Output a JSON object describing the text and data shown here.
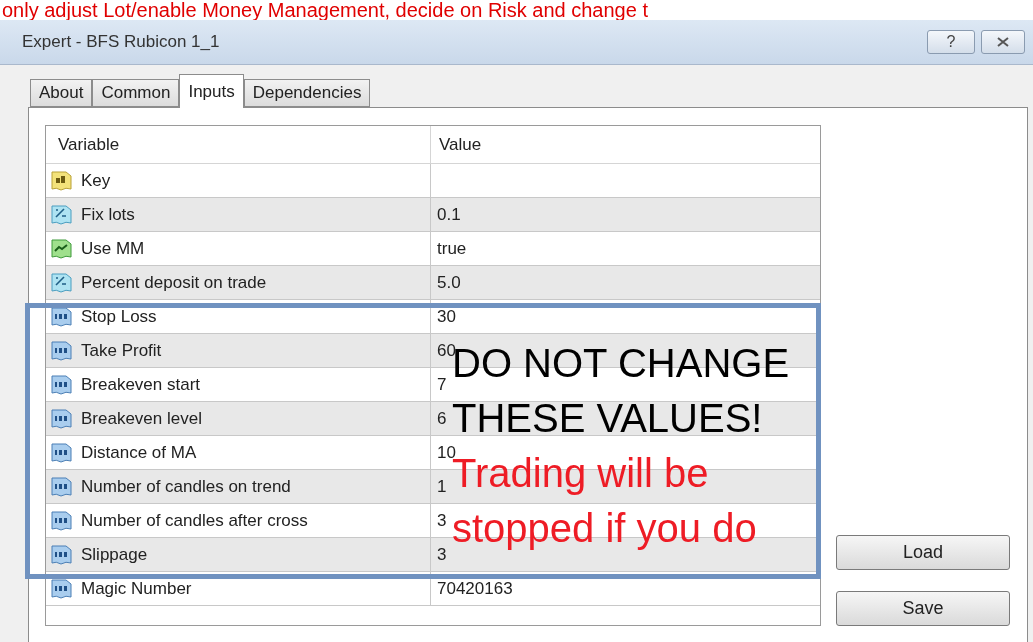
{
  "banner": "only adjust Lot/enable Money Management, decide on Risk and change t",
  "window": {
    "title": "Expert - BFS Rubicon 1_1",
    "help_button": "?"
  },
  "tabs": [
    {
      "label": "About",
      "selected": false
    },
    {
      "label": "Common",
      "selected": false
    },
    {
      "label": "Inputs",
      "selected": true
    },
    {
      "label": "Dependencies",
      "selected": false
    }
  ],
  "table": {
    "columns": [
      "Variable",
      "Value"
    ],
    "rows": [
      {
        "kind": "string",
        "variable": "Key",
        "value": ""
      },
      {
        "kind": "double",
        "variable": "Fix lots",
        "value": "0.1"
      },
      {
        "kind": "bool",
        "variable": "Use MM",
        "value": "true"
      },
      {
        "kind": "double",
        "variable": "Percent deposit on trade",
        "value": "5.0"
      },
      {
        "kind": "int",
        "variable": "Stop Loss",
        "value": "30"
      },
      {
        "kind": "int",
        "variable": "Take Profit",
        "value": "60"
      },
      {
        "kind": "int",
        "variable": "Breakeven start",
        "value": "7"
      },
      {
        "kind": "int",
        "variable": "Breakeven level",
        "value": "6"
      },
      {
        "kind": "int",
        "variable": "Distance of MA",
        "value": "10"
      },
      {
        "kind": "int",
        "variable": "Number of candles on trend",
        "value": "1"
      },
      {
        "kind": "int",
        "variable": "Number of candles after cross",
        "value": "3"
      },
      {
        "kind": "int",
        "variable": "Slippage",
        "value": "3"
      },
      {
        "kind": "int",
        "variable": "Magic Number",
        "value": "70420163"
      }
    ]
  },
  "overlay": {
    "warning": "DO NOT CHANGE THESE VALUES!",
    "consequence": "Trading will be stopped if you do"
  },
  "buttons": [
    "Load",
    "Save"
  ]
}
